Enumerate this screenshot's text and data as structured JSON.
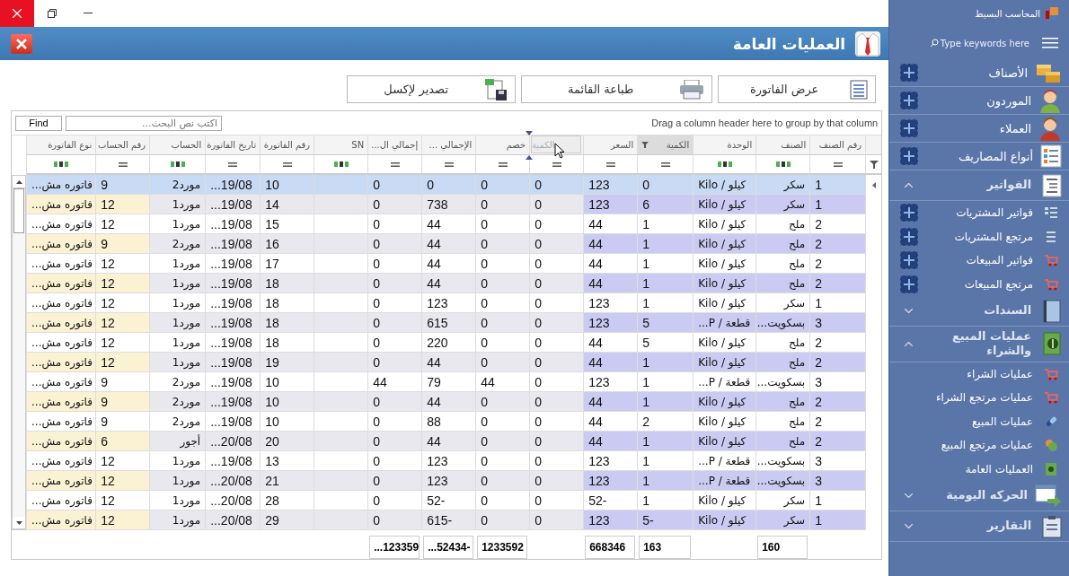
{
  "title_bar": {
    "title": "العمليات العامة"
  },
  "toolbar": {
    "buttons": [
      {
        "label": "عرض الفاتورة"
      },
      {
        "label": "طباعة القائمة"
      },
      {
        "label": "تصدير لإكسل"
      }
    ]
  },
  "grid": {
    "group_hint": "Drag a column header here to group by that column",
    "search_placeholder": "اكتب نص البحث...",
    "find_button": "Find",
    "drag_ghost": "الكمية",
    "columns": [
      {
        "header": "رقم الصنف",
        "kind": "number",
        "filtered": false
      },
      {
        "header": "الصنف",
        "kind": "text",
        "filtered": false,
        "total": "160"
      },
      {
        "header": "الوحدة",
        "kind": "text",
        "filtered": false
      },
      {
        "header": "الكمية",
        "kind": "number",
        "filtered": true,
        "total": "163"
      },
      {
        "header": "السعر",
        "kind": "number",
        "filtered": false,
        "total": "668346"
      },
      {
        "kind": "number",
        "filtered": false
      },
      {
        "header": "خصم",
        "kind": "number",
        "filtered": false,
        "total": "1233592"
      },
      {
        "header": "الإجمالي ...",
        "kind": "number",
        "filtered": false,
        "total": "...52434-"
      },
      {
        "header": "إجمالي ال...",
        "kind": "number",
        "filtered": false,
        "total": "...123359"
      },
      {
        "header": "SN",
        "kind": "text",
        "filtered": false
      },
      {
        "header": "رقم الفاتورة",
        "kind": "number",
        "filtered": false
      },
      {
        "header": "تاريخ الفاتورة",
        "kind": "number",
        "filtered": false
      },
      {
        "header": "الحساب",
        "kind": "text",
        "filtered": false
      },
      {
        "header": "رقم الحساب",
        "kind": "number",
        "filtered": false
      },
      {
        "header": "نوع الفاتورة",
        "kind": "text",
        "filtered": false
      }
    ],
    "rows": [
      {
        "selected": true,
        "cells": [
          "1",
          "سكر",
          "كيلو / Kilo",
          "0",
          "123",
          "0",
          "0",
          "0",
          "0",
          null,
          "10",
          "...19/08",
          "مورد2",
          "9",
          "فاتوره مش..."
        ]
      },
      {
        "selected": false,
        "cells": [
          "1",
          "سكر",
          "كيلو / Kilo",
          "6",
          "123",
          "0",
          "0",
          "738",
          "0",
          null,
          "14",
          "...19/08",
          "مورد1",
          "12",
          "فاتوره مش..."
        ]
      },
      {
        "selected": false,
        "cells": [
          "2",
          "ملح",
          "كيلو / Kilo",
          "1",
          "44",
          "0",
          "0",
          "44",
          "0",
          null,
          "15",
          "...19/08",
          "مورد1",
          "12",
          "فاتوره مش..."
        ]
      },
      {
        "selected": false,
        "cells": [
          "2",
          "ملح",
          "كيلو / Kilo",
          "1",
          "44",
          "0",
          "0",
          "44",
          "0",
          null,
          "16",
          "...19/08",
          "مورد2",
          "9",
          "فاتوره مش..."
        ]
      },
      {
        "selected": false,
        "cells": [
          "2",
          "ملح",
          "كيلو / Kilo",
          "1",
          "44",
          "0",
          "0",
          "44",
          "0",
          null,
          "17",
          "...19/08",
          "مورد1",
          "12",
          "فاتوره مش..."
        ]
      },
      {
        "selected": false,
        "cells": [
          "2",
          "ملح",
          "كيلو / Kilo",
          "1",
          "44",
          "0",
          "0",
          "44",
          "0",
          null,
          "18",
          "...19/08",
          "مورد1",
          "12",
          "فاتوره مش..."
        ]
      },
      {
        "selected": false,
        "cells": [
          "1",
          "سكر",
          "كيلو / Kilo",
          "1",
          "123",
          "0",
          "0",
          "123",
          "0",
          null,
          "18",
          "...19/08",
          "مورد1",
          "12",
          "فاتوره مش..."
        ]
      },
      {
        "selected": false,
        "cells": [
          "3",
          "بسكويت...",
          "قطعة / P...",
          "5",
          "123",
          "0",
          "0",
          "615",
          "0",
          null,
          "18",
          "...19/08",
          "مورد1",
          "12",
          "فاتوره مش..."
        ]
      },
      {
        "selected": false,
        "cells": [
          "2",
          "ملح",
          "كيلو / Kilo",
          "5",
          "44",
          "0",
          "0",
          "220",
          "0",
          null,
          "18",
          "...19/08",
          "مورد1",
          "12",
          "فاتوره مش..."
        ]
      },
      {
        "selected": false,
        "cells": [
          "2",
          "ملح",
          "كيلو / Kilo",
          "1",
          "44",
          "0",
          "0",
          "44",
          "0",
          null,
          "19",
          "...19/08",
          "مورد1",
          "12",
          "فاتوره مش..."
        ]
      },
      {
        "selected": false,
        "cells": [
          "3",
          "بسكويت...",
          "قطعة / P...",
          "1",
          "123",
          "0",
          "44",
          "79",
          "44",
          null,
          "10",
          "...19/08",
          "مورد2",
          "9",
          "فاتوره مش..."
        ]
      },
      {
        "selected": false,
        "cells": [
          "2",
          "ملح",
          "كيلو / Kilo",
          "1",
          "44",
          "0",
          "0",
          "44",
          "0",
          null,
          "10",
          "...19/08",
          "مورد2",
          "9",
          "فاتوره مش..."
        ]
      },
      {
        "selected": false,
        "cells": [
          "2",
          "ملح",
          "كيلو / Kilo",
          "2",
          "44",
          "0",
          "0",
          "88",
          "0",
          null,
          "10",
          "...19/08",
          "مورد2",
          "9",
          "فاتوره مش..."
        ]
      },
      {
        "selected": false,
        "cells": [
          "2",
          "ملح",
          "كيلو / Kilo",
          "1",
          "44",
          "0",
          "0",
          "44",
          "0",
          null,
          "20",
          "...20/08",
          "أجور",
          "6",
          "فاتوره مش..."
        ]
      },
      {
        "selected": false,
        "cells": [
          "3",
          "بسكويت...",
          "قطعة / P...",
          "1",
          "123",
          "0",
          "0",
          "123",
          "0",
          null,
          "13",
          "...19/08",
          "مورد1",
          "12",
          "فاتوره مش..."
        ]
      },
      {
        "selected": false,
        "cells": [
          "3",
          "بسكويت...",
          "قطعة / P...",
          "1",
          "123",
          "0",
          "0",
          "123",
          "0",
          null,
          "21",
          "...20/08",
          "مورد1",
          "12",
          "فاتوره مش..."
        ]
      },
      {
        "selected": false,
        "cells": [
          "1",
          "سكر",
          "كيلو / Kilo",
          "1",
          "52-",
          "0",
          "0",
          "52-",
          "0",
          null,
          "28",
          "...20/08",
          "مورد1",
          "12",
          "فاتوره مش..."
        ]
      },
      {
        "selected": false,
        "cells": [
          "1",
          "سكر",
          "كيلو / Kilo",
          "5-",
          "123",
          "0",
          "0",
          "615-",
          "0",
          null,
          "29",
          "...20/08",
          "مورد1",
          "12",
          "فاتوره مش..."
        ]
      }
    ]
  },
  "sidebar": {
    "app_title": "المحاسب البسيط",
    "search_placeholder": "Type keywords here",
    "entries": [
      {
        "kind": "item",
        "label": "الأصناف",
        "add": true
      },
      {
        "kind": "item",
        "label": "الموردون",
        "add": true
      },
      {
        "kind": "item",
        "label": "العملاء",
        "add": true
      },
      {
        "kind": "item",
        "label": "أنواع المصاريف",
        "add": true
      },
      {
        "kind": "group",
        "label": "الفواتير",
        "expanded": true,
        "children": [
          {
            "label": "فواتير المشتريات",
            "add": true
          },
          {
            "label": "مرتجع المشتريات",
            "add": true
          },
          {
            "label": "فواتير المبيعات",
            "add": true
          },
          {
            "label": "مرتجع المبيعات",
            "add": true
          }
        ]
      },
      {
        "kind": "group",
        "label": "السندات",
        "expanded": false
      },
      {
        "kind": "group",
        "label": "عمليات المبيع والشراء",
        "expanded": true,
        "children": [
          {
            "label": "عمليات الشراء",
            "add": false
          },
          {
            "label": "عمليات مرتجع الشراء",
            "add": false
          },
          {
            "label": "عمليات المبيع",
            "add": false
          },
          {
            "label": "عمليات مرتجع المبيع",
            "add": false
          },
          {
            "label": "العمليات العامة",
            "add": false
          }
        ]
      },
      {
        "kind": "group",
        "label": "الحركه اليومية",
        "expanded": false
      },
      {
        "kind": "group",
        "label": "التقارير",
        "expanded": false
      }
    ]
  }
}
